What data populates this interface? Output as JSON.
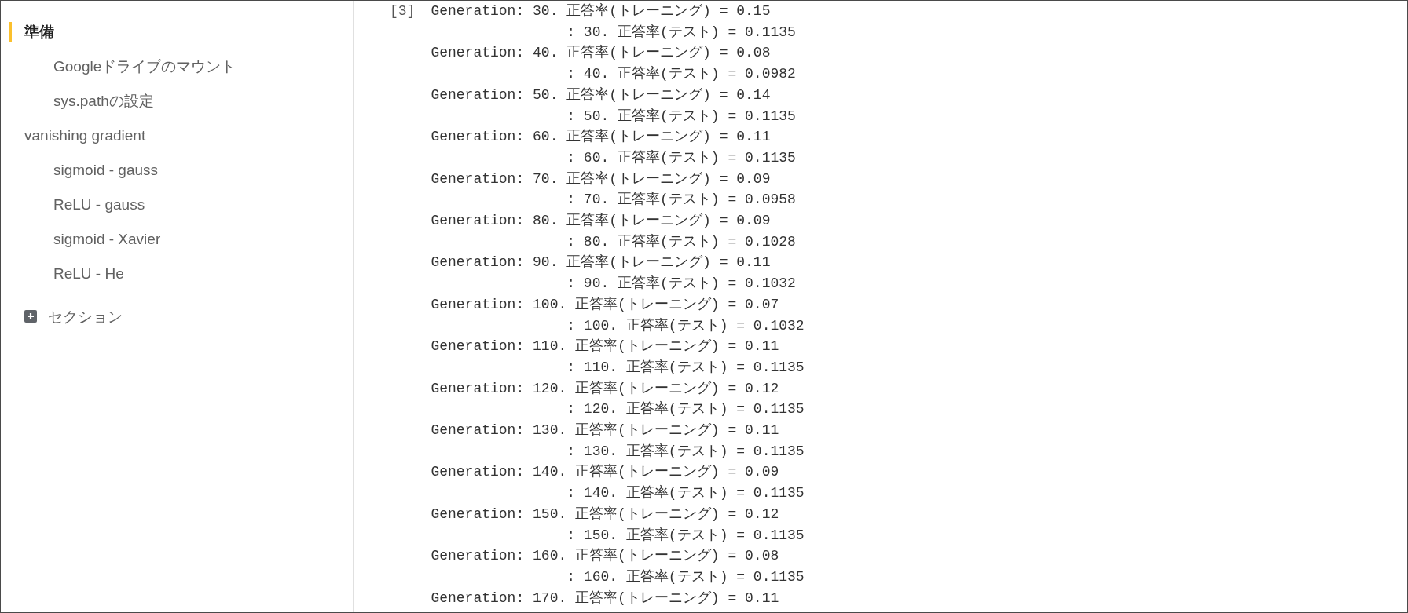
{
  "sidebar": {
    "items": [
      {
        "label": "準備",
        "selected": true,
        "children": [
          {
            "label": "Googleドライブのマウント",
            "selected": false
          },
          {
            "label": "sys.pathの設定",
            "selected": false
          }
        ]
      },
      {
        "label": "vanishing gradient",
        "selected": false,
        "children": [
          {
            "label": "sigmoid - gauss",
            "selected": false
          },
          {
            "label": "ReLU - gauss",
            "selected": false
          },
          {
            "label": "sigmoid - Xavier",
            "selected": false
          },
          {
            "label": "ReLU - He",
            "selected": false
          }
        ]
      }
    ],
    "add_section": {
      "label": "セクション"
    }
  },
  "output": {
    "execution_count": "[3]",
    "lines": [
      {
        "kind": "train",
        "text": "Generation: 30. 正答率(トレーニング) = 0.15"
      },
      {
        "kind": "test",
        "text": ": 30. 正答率(テスト) = 0.1135"
      },
      {
        "kind": "train",
        "text": "Generation: 40. 正答率(トレーニング) = 0.08"
      },
      {
        "kind": "test",
        "text": ": 40. 正答率(テスト) = 0.0982"
      },
      {
        "kind": "train",
        "text": "Generation: 50. 正答率(トレーニング) = 0.14"
      },
      {
        "kind": "test",
        "text": ": 50. 正答率(テスト) = 0.1135"
      },
      {
        "kind": "train",
        "text": "Generation: 60. 正答率(トレーニング) = 0.11"
      },
      {
        "kind": "test",
        "text": ": 60. 正答率(テスト) = 0.1135"
      },
      {
        "kind": "train",
        "text": "Generation: 70. 正答率(トレーニング) = 0.09"
      },
      {
        "kind": "test",
        "text": ": 70. 正答率(テスト) = 0.0958"
      },
      {
        "kind": "train",
        "text": "Generation: 80. 正答率(トレーニング) = 0.09"
      },
      {
        "kind": "test",
        "text": ": 80. 正答率(テスト) = 0.1028"
      },
      {
        "kind": "train",
        "text": "Generation: 90. 正答率(トレーニング) = 0.11"
      },
      {
        "kind": "test",
        "text": ": 90. 正答率(テスト) = 0.1032"
      },
      {
        "kind": "train",
        "text": "Generation: 100. 正答率(トレーニング) = 0.07"
      },
      {
        "kind": "test",
        "text": ": 100. 正答率(テスト) = 0.1032"
      },
      {
        "kind": "train",
        "text": "Generation: 110. 正答率(トレーニング) = 0.11"
      },
      {
        "kind": "test",
        "text": ": 110. 正答率(テスト) = 0.1135"
      },
      {
        "kind": "train",
        "text": "Generation: 120. 正答率(トレーニング) = 0.12"
      },
      {
        "kind": "test",
        "text": ": 120. 正答率(テスト) = 0.1135"
      },
      {
        "kind": "train",
        "text": "Generation: 130. 正答率(トレーニング) = 0.11"
      },
      {
        "kind": "test",
        "text": ": 130. 正答率(テスト) = 0.1135"
      },
      {
        "kind": "train",
        "text": "Generation: 140. 正答率(トレーニング) = 0.09"
      },
      {
        "kind": "test",
        "text": ": 140. 正答率(テスト) = 0.1135"
      },
      {
        "kind": "train",
        "text": "Generation: 150. 正答率(トレーニング) = 0.12"
      },
      {
        "kind": "test",
        "text": ": 150. 正答率(テスト) = 0.1135"
      },
      {
        "kind": "train",
        "text": "Generation: 160. 正答率(トレーニング) = 0.08"
      },
      {
        "kind": "test",
        "text": ": 160. 正答率(テスト) = 0.1135"
      },
      {
        "kind": "train",
        "text": "Generation: 170. 正答率(トレーニング) = 0.11"
      }
    ]
  }
}
